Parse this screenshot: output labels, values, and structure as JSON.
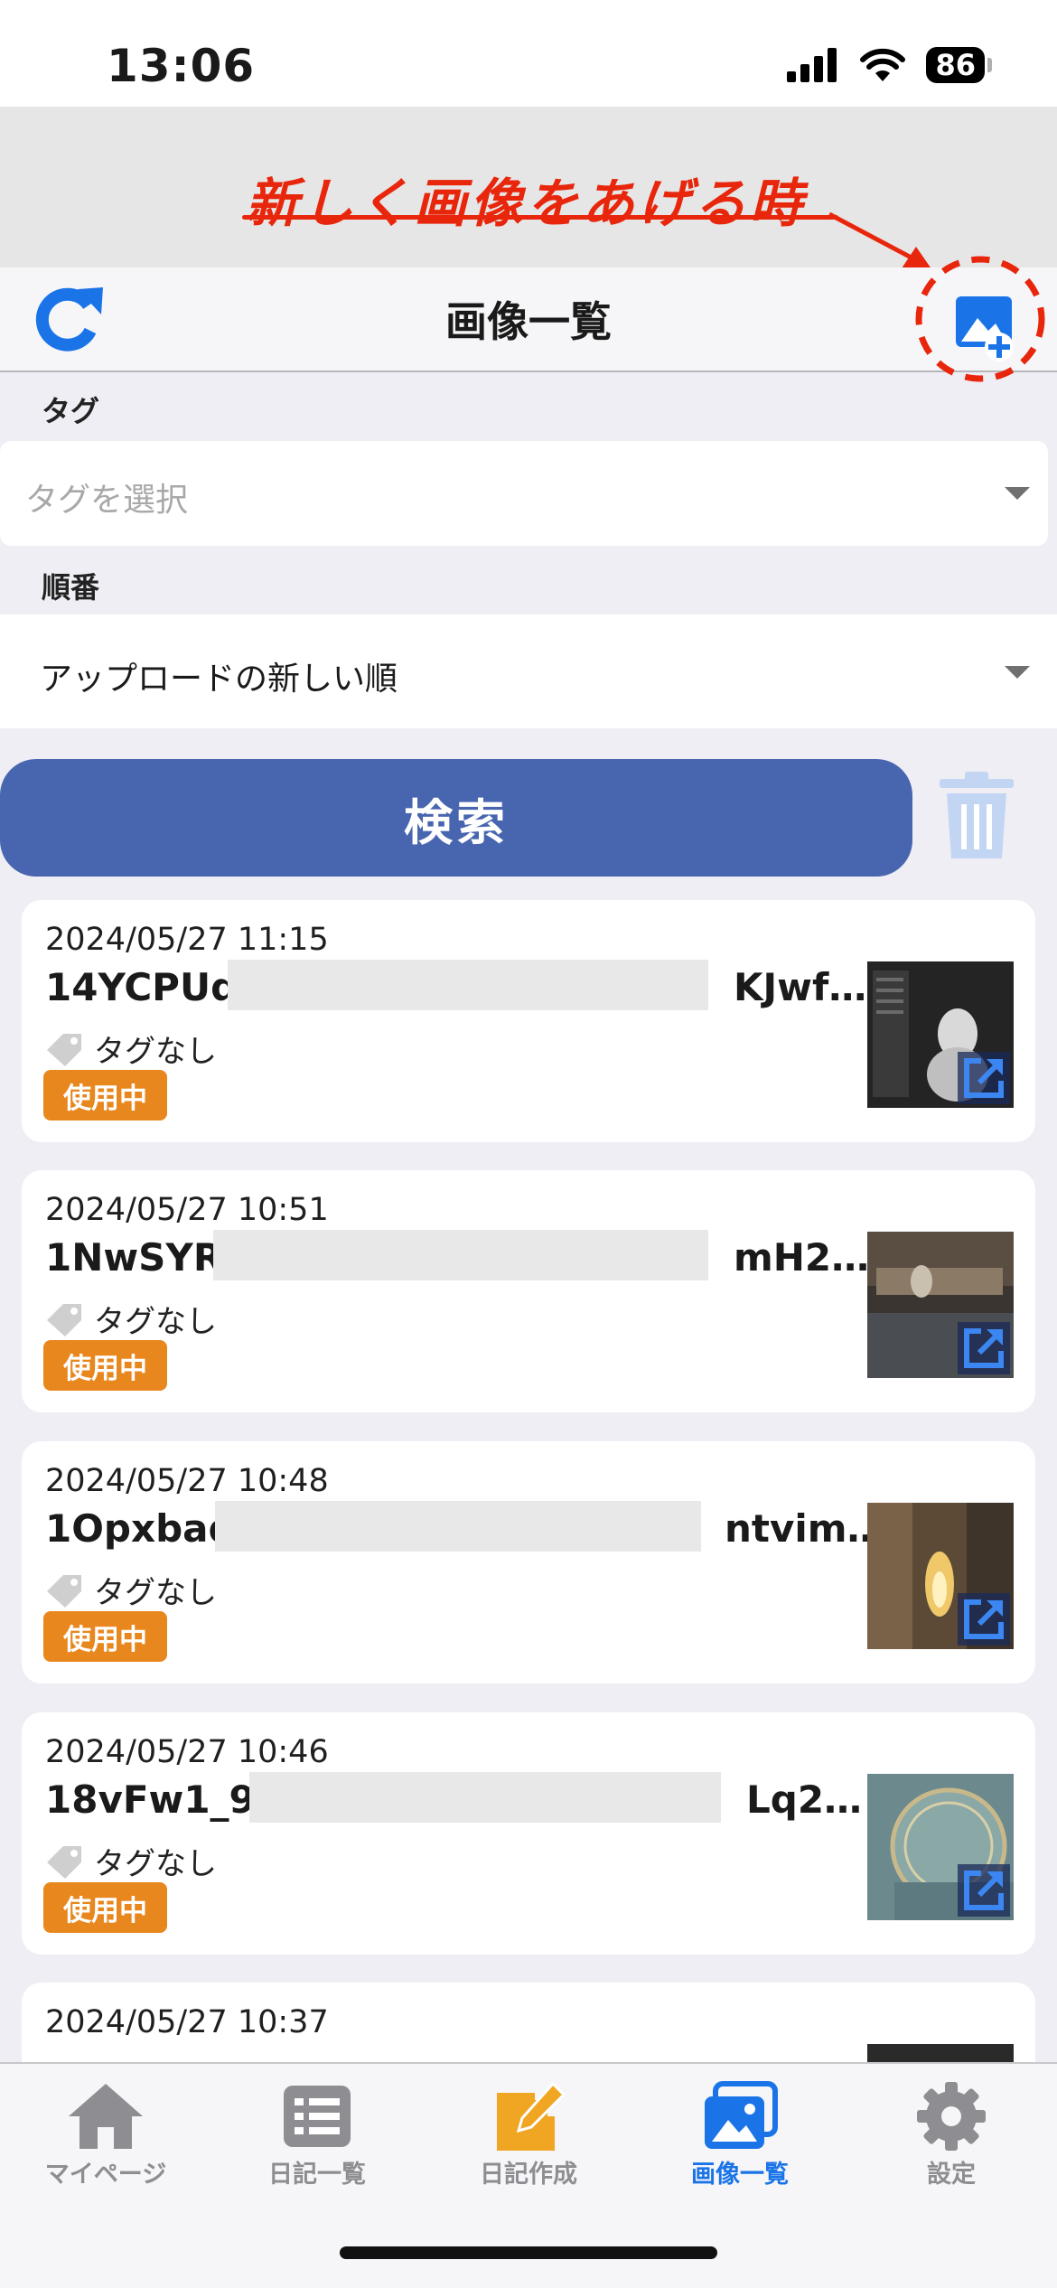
{
  "status": {
    "time": "13:06",
    "battery": "86"
  },
  "annotation": {
    "text": "新しく画像をあげる時"
  },
  "header": {
    "title": "画像一覧"
  },
  "filters": {
    "tag_label": "タグ",
    "tag_placeholder": "タグを選択",
    "order_label": "順番",
    "order_value": "アップロードの新しい順"
  },
  "search": {
    "label": "検索"
  },
  "colors": {
    "primary": "#4865b0",
    "accent_orange": "#e8871e",
    "annotation_red": "#e8260c",
    "tab_active": "#1a74e8",
    "tab_inactive": "#8d8d92"
  },
  "images": [
    {
      "date": "2024/05/27 11:15",
      "title_start": "14YCPUq",
      "title_end": "KJwf…",
      "tag": "タグなし",
      "badge": "使用中"
    },
    {
      "date": "2024/05/27 10:51",
      "title_start": "1NwSYR",
      "title_end": "mH2…",
      "tag": "タグなし",
      "badge": "使用中"
    },
    {
      "date": "2024/05/27 10:48",
      "title_start": "1Opxbad",
      "title_end": "ntvim…",
      "tag": "タグなし",
      "badge": "使用中"
    },
    {
      "date": "2024/05/27 10:46",
      "title_start": "18vFw1_9",
      "title_end": "Lq2…",
      "tag": "タグなし",
      "badge": "使用中"
    },
    {
      "date": "2024/05/27 10:37"
    }
  ],
  "tabs": [
    {
      "label": "マイページ",
      "icon": "home-icon"
    },
    {
      "label": "日記一覧",
      "icon": "list-icon"
    },
    {
      "label": "日記作成",
      "icon": "edit-icon"
    },
    {
      "label": "画像一覧",
      "icon": "images-icon",
      "active": true
    },
    {
      "label": "設定",
      "icon": "gear-icon"
    }
  ]
}
